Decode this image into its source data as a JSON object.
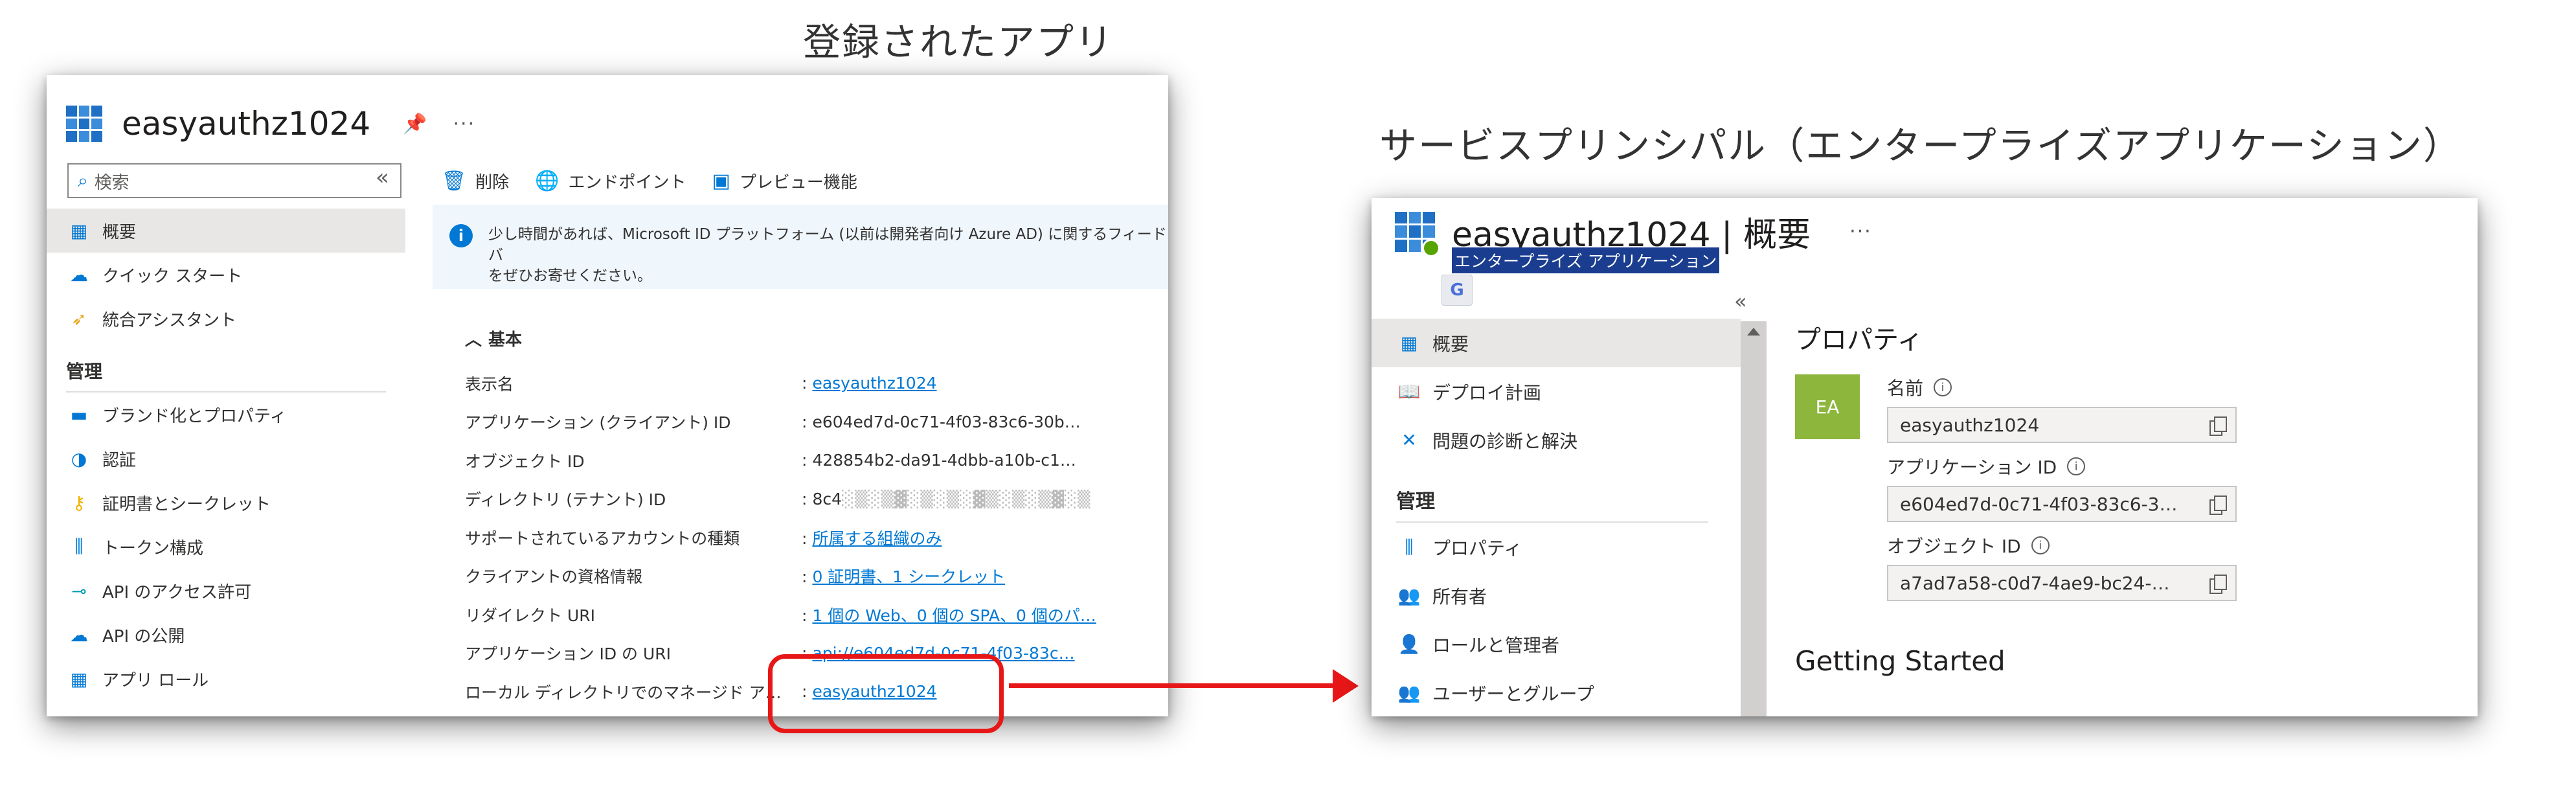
{
  "captions": {
    "left": "登録されたアプリ",
    "right": "サービスプリンシパル（エンタープライズアプリケーション）"
  },
  "left_panel": {
    "title": "easyauthz1024",
    "more": "···",
    "search_placeholder": "検索",
    "collapse": "«",
    "nav": [
      {
        "label": "概要",
        "icon": "grid-icon",
        "active": true
      },
      {
        "label": "クイック スタート",
        "icon": "cloud-rocket-icon"
      },
      {
        "label": "統合アシスタント",
        "icon": "rocket-icon"
      }
    ],
    "nav_section": "管理",
    "nav_manage": [
      {
        "label": "ブランド化とプロパティ",
        "icon": "branding-icon"
      },
      {
        "label": "認証",
        "icon": "auth-icon"
      },
      {
        "label": "証明書とシークレット",
        "icon": "key-icon"
      },
      {
        "label": "トークン構成",
        "icon": "token-config-icon"
      },
      {
        "label": "API のアクセス許可",
        "icon": "api-permission-icon"
      },
      {
        "label": "API の公開",
        "icon": "cloud-api-icon"
      },
      {
        "label": "アプリ ロール",
        "icon": "app-roles-icon"
      }
    ],
    "toolbar": {
      "delete": "削除",
      "endpoints": "エンドポイント",
      "preview": "プレビュー機能"
    },
    "banner": "少し時間があれば、Microsoft ID プラットフォーム (以前は開発者向け Azure AD) に関するフィードバ\nをぜひお寄せください。",
    "essentials_header": "基本",
    "essentials": [
      {
        "key": "表示名",
        "value": "easyauthz1024",
        "link": true
      },
      {
        "key": "アプリケーション (クライアント) ID",
        "value": "e604ed7d-0c71-4f03-83c6-30b…",
        "link": false
      },
      {
        "key": "オブジェクト ID",
        "value": "428854b2-da91-4dbb-a10b-c1…",
        "link": false
      },
      {
        "key": "ディレクトリ (テナント) ID",
        "value": "8c4",
        "link": false,
        "blur": "░▒░▒▓░▒░▒░▓▒░▒░▒▓░▒"
      },
      {
        "key": "サポートされているアカウントの種類",
        "value": "所属する組織のみ",
        "link": true
      },
      {
        "key": "クライアントの資格情報",
        "value": "0 証明書、1 シークレット",
        "link": true
      },
      {
        "key": "リダイレクト URI",
        "value": "1 個の Web、0 個の SPA、0 個のパ…",
        "link": true
      },
      {
        "key": "アプリケーション ID の URI",
        "value": "api://e604ed7d-0c71-4f03-83c…",
        "link": true
      },
      {
        "key": "ローカル ディレクトリでのマネージド アプリケー…",
        "value": "easyauthz1024",
        "link": true
      }
    ]
  },
  "right_panel": {
    "title": "easyauthz1024 | 概要",
    "more": "···",
    "subtitle": "エンタープライズ アプリケーション",
    "translate": "G",
    "collapse": "«",
    "nav": [
      {
        "label": "概要",
        "icon": "grid-icon",
        "active": true
      },
      {
        "label": "デプロイ計画",
        "icon": "book-icon"
      },
      {
        "label": "問題の診断と解決",
        "icon": "wrench-icon"
      }
    ],
    "nav_section": "管理",
    "nav_manage": [
      {
        "label": "プロパティ",
        "icon": "properties-icon"
      },
      {
        "label": "所有者",
        "icon": "owners-icon"
      },
      {
        "label": "ロールと管理者",
        "icon": "roles-icon"
      },
      {
        "label": "ユーザーとグループ",
        "icon": "users-groups-icon"
      }
    ],
    "section_title": "プロパティ",
    "tile": "EA",
    "properties": [
      {
        "label": "名前",
        "value": "easyauthz1024"
      },
      {
        "label": "アプリケーション ID",
        "value": "e604ed7d-0c71-4f03-83c6-3…"
      },
      {
        "label": "オブジェクト ID",
        "value": "a7ad7a58-c0d7-4ae9-bc24-…"
      }
    ],
    "getting_started": "Getting Started"
  },
  "colors": {
    "accent": "#0078d4",
    "highlight": "#e81717",
    "tile": "#8db63c",
    "subtitle_bg": "#1a3d8f"
  }
}
